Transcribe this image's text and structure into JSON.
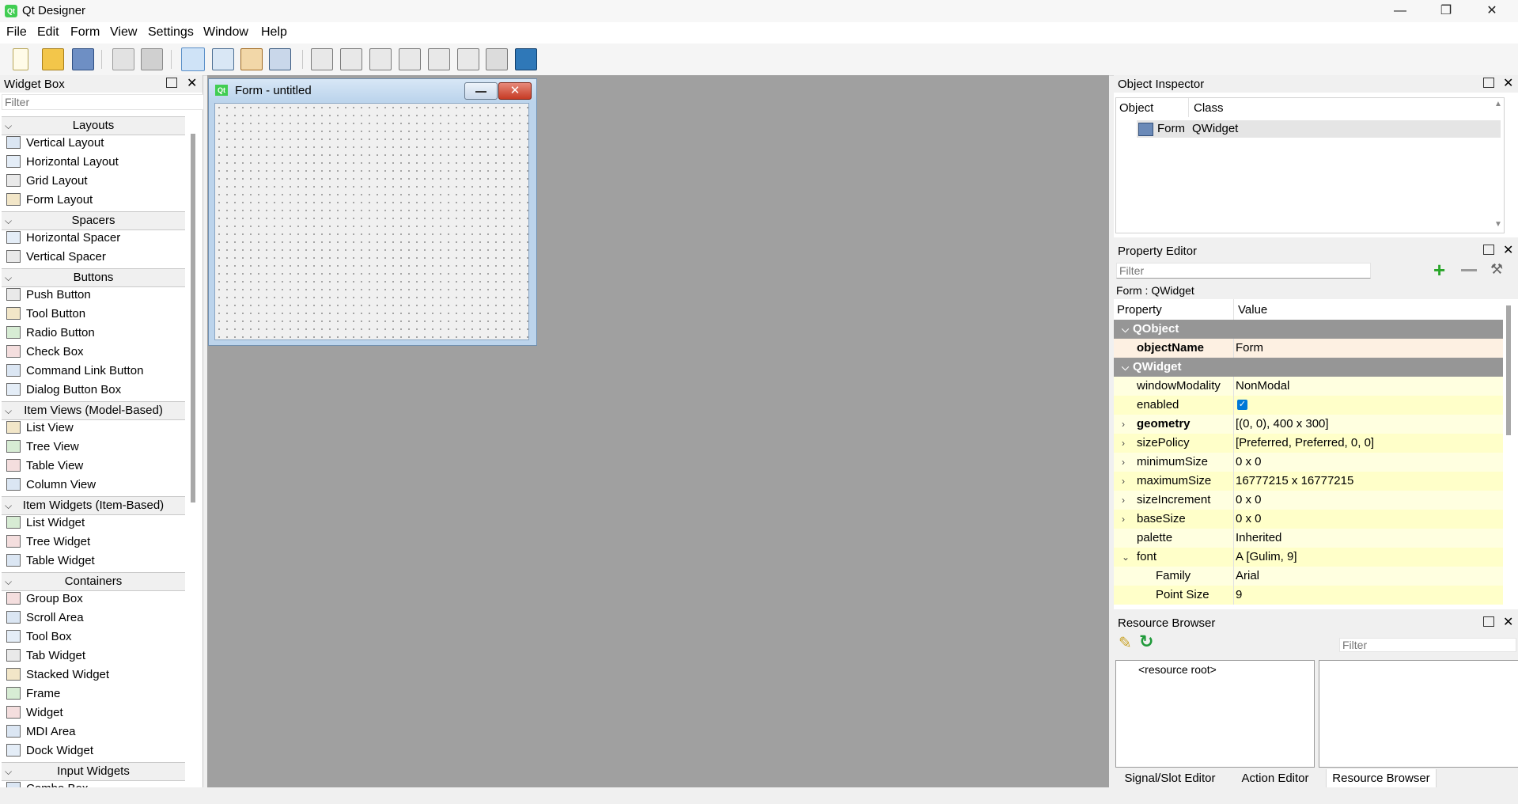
{
  "window": {
    "title": "Qt Designer",
    "minimize": "—",
    "maximize": "❐",
    "close": "✕"
  },
  "menu": [
    "File",
    "Edit",
    "Form",
    "View",
    "Settings",
    "Window",
    "Help"
  ],
  "toolbar_icons": [
    "new-form-icon",
    "open-form-icon",
    "save-form-icon",
    "send-to-back-icon",
    "bring-to-front-icon",
    "edit-widgets-icon",
    "edit-signals-slots-icon",
    "edit-buddies-icon",
    "edit-tab-order-icon",
    "layout-horizontally-icon",
    "layout-vertically-icon",
    "layout-horizontal-splitter-icon",
    "layout-vertical-splitter-icon",
    "layout-grid-icon",
    "layout-form-icon",
    "break-layout-icon",
    "adjust-size-icon"
  ],
  "widget_box": {
    "title": "Widget Box",
    "filter_placeholder": "Filter",
    "categories": [
      {
        "name": "Layouts",
        "items": [
          "Vertical Layout",
          "Horizontal Layout",
          "Grid Layout",
          "Form Layout"
        ]
      },
      {
        "name": "Spacers",
        "items": [
          "Horizontal Spacer",
          "Vertical Spacer"
        ]
      },
      {
        "name": "Buttons",
        "items": [
          "Push Button",
          "Tool Button",
          "Radio Button",
          "Check Box",
          "Command Link Button",
          "Dialog Button Box"
        ]
      },
      {
        "name": "Item Views (Model-Based)",
        "items": [
          "List View",
          "Tree View",
          "Table View",
          "Column View"
        ]
      },
      {
        "name": "Item Widgets (Item-Based)",
        "items": [
          "List Widget",
          "Tree Widget",
          "Table Widget"
        ]
      },
      {
        "name": "Containers",
        "items": [
          "Group Box",
          "Scroll Area",
          "Tool Box",
          "Tab Widget",
          "Stacked Widget",
          "Frame",
          "Widget",
          "MDI Area",
          "Dock Widget"
        ]
      },
      {
        "name": "Input Widgets",
        "items": [
          "Combo Box"
        ]
      }
    ]
  },
  "form": {
    "title": "Form - untitled",
    "icon": "Qt"
  },
  "object_inspector": {
    "title": "Object Inspector",
    "col_object": "Object",
    "col_class": "Class",
    "row_object": "Form",
    "row_class": "QWidget"
  },
  "property_editor": {
    "title": "Property Editor",
    "filter_placeholder": "Filter",
    "context": "Form : QWidget",
    "col_property": "Property",
    "col_value": "Value",
    "rows": [
      {
        "name": "QObject",
        "value": "",
        "kind": "group"
      },
      {
        "name": "objectName",
        "value": "Form",
        "kind": "obj"
      },
      {
        "name": "QWidget",
        "value": "",
        "kind": "group"
      },
      {
        "name": "windowModality",
        "value": "NonModal",
        "kind": "y1"
      },
      {
        "name": "enabled",
        "value": "",
        "kind": "y2",
        "checked": true
      },
      {
        "name": "geometry",
        "value": "[(0, 0), 400 x 300]",
        "kind": "y1",
        "expand": "›",
        "bold": true
      },
      {
        "name": "sizePolicy",
        "value": "[Preferred, Preferred, 0, 0]",
        "kind": "y2",
        "expand": "›"
      },
      {
        "name": "minimumSize",
        "value": "0 x 0",
        "kind": "y1",
        "expand": "›"
      },
      {
        "name": "maximumSize",
        "value": "16777215 x 16777215",
        "kind": "y2",
        "expand": "›"
      },
      {
        "name": "sizeIncrement",
        "value": "0 x 0",
        "kind": "y1",
        "expand": "›"
      },
      {
        "name": "baseSize",
        "value": "0 x 0",
        "kind": "y2",
        "expand": "›"
      },
      {
        "name": "palette",
        "value": "Inherited",
        "kind": "y1"
      },
      {
        "name": "font",
        "value": "A [Gulim, 9]",
        "kind": "y2",
        "expand": "⌄"
      },
      {
        "name": "Family",
        "value": "Arial",
        "kind": "y1",
        "indent": true
      },
      {
        "name": "Point Size",
        "value": "9",
        "kind": "y2",
        "indent": true
      }
    ]
  },
  "resource_browser": {
    "title": "Resource Browser",
    "filter_placeholder": "Filter",
    "root": "<resource root>"
  },
  "bottom_tabs": [
    "Signal/Slot Editor",
    "Action Editor",
    "Resource Browser"
  ],
  "colors": {
    "accent": "#0078d7",
    "group_header": "#969696",
    "mdi_bg": "#a0a0a0"
  }
}
